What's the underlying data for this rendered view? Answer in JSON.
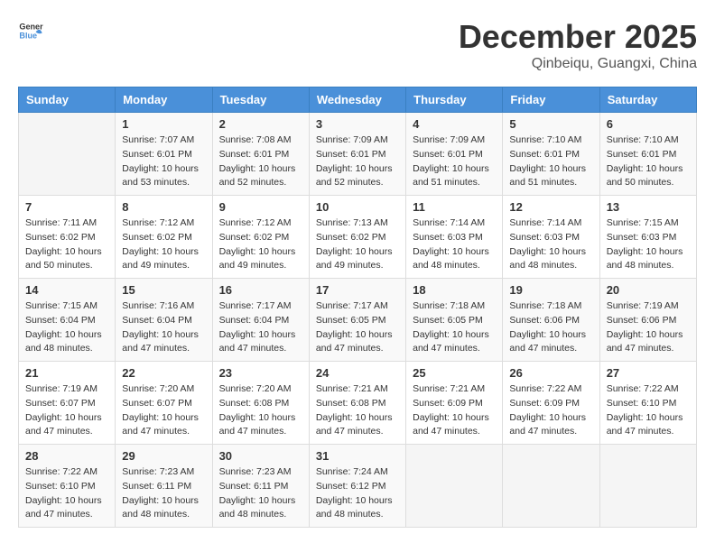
{
  "header": {
    "logo_general": "General",
    "logo_blue": "Blue",
    "month": "December 2025",
    "location": "Qinbeiqu, Guangxi, China"
  },
  "weekdays": [
    "Sunday",
    "Monday",
    "Tuesday",
    "Wednesday",
    "Thursday",
    "Friday",
    "Saturday"
  ],
  "weeks": [
    [
      {
        "day": "",
        "sunrise": "",
        "sunset": "",
        "daylight": ""
      },
      {
        "day": "1",
        "sunrise": "Sunrise: 7:07 AM",
        "sunset": "Sunset: 6:01 PM",
        "daylight": "Daylight: 10 hours and 53 minutes."
      },
      {
        "day": "2",
        "sunrise": "Sunrise: 7:08 AM",
        "sunset": "Sunset: 6:01 PM",
        "daylight": "Daylight: 10 hours and 52 minutes."
      },
      {
        "day": "3",
        "sunrise": "Sunrise: 7:09 AM",
        "sunset": "Sunset: 6:01 PM",
        "daylight": "Daylight: 10 hours and 52 minutes."
      },
      {
        "day": "4",
        "sunrise": "Sunrise: 7:09 AM",
        "sunset": "Sunset: 6:01 PM",
        "daylight": "Daylight: 10 hours and 51 minutes."
      },
      {
        "day": "5",
        "sunrise": "Sunrise: 7:10 AM",
        "sunset": "Sunset: 6:01 PM",
        "daylight": "Daylight: 10 hours and 51 minutes."
      },
      {
        "day": "6",
        "sunrise": "Sunrise: 7:10 AM",
        "sunset": "Sunset: 6:01 PM",
        "daylight": "Daylight: 10 hours and 50 minutes."
      }
    ],
    [
      {
        "day": "7",
        "sunrise": "Sunrise: 7:11 AM",
        "sunset": "Sunset: 6:02 PM",
        "daylight": "Daylight: 10 hours and 50 minutes."
      },
      {
        "day": "8",
        "sunrise": "Sunrise: 7:12 AM",
        "sunset": "Sunset: 6:02 PM",
        "daylight": "Daylight: 10 hours and 49 minutes."
      },
      {
        "day": "9",
        "sunrise": "Sunrise: 7:12 AM",
        "sunset": "Sunset: 6:02 PM",
        "daylight": "Daylight: 10 hours and 49 minutes."
      },
      {
        "day": "10",
        "sunrise": "Sunrise: 7:13 AM",
        "sunset": "Sunset: 6:02 PM",
        "daylight": "Daylight: 10 hours and 49 minutes."
      },
      {
        "day": "11",
        "sunrise": "Sunrise: 7:14 AM",
        "sunset": "Sunset: 6:03 PM",
        "daylight": "Daylight: 10 hours and 48 minutes."
      },
      {
        "day": "12",
        "sunrise": "Sunrise: 7:14 AM",
        "sunset": "Sunset: 6:03 PM",
        "daylight": "Daylight: 10 hours and 48 minutes."
      },
      {
        "day": "13",
        "sunrise": "Sunrise: 7:15 AM",
        "sunset": "Sunset: 6:03 PM",
        "daylight": "Daylight: 10 hours and 48 minutes."
      }
    ],
    [
      {
        "day": "14",
        "sunrise": "Sunrise: 7:15 AM",
        "sunset": "Sunset: 6:04 PM",
        "daylight": "Daylight: 10 hours and 48 minutes."
      },
      {
        "day": "15",
        "sunrise": "Sunrise: 7:16 AM",
        "sunset": "Sunset: 6:04 PM",
        "daylight": "Daylight: 10 hours and 47 minutes."
      },
      {
        "day": "16",
        "sunrise": "Sunrise: 7:17 AM",
        "sunset": "Sunset: 6:04 PM",
        "daylight": "Daylight: 10 hours and 47 minutes."
      },
      {
        "day": "17",
        "sunrise": "Sunrise: 7:17 AM",
        "sunset": "Sunset: 6:05 PM",
        "daylight": "Daylight: 10 hours and 47 minutes."
      },
      {
        "day": "18",
        "sunrise": "Sunrise: 7:18 AM",
        "sunset": "Sunset: 6:05 PM",
        "daylight": "Daylight: 10 hours and 47 minutes."
      },
      {
        "day": "19",
        "sunrise": "Sunrise: 7:18 AM",
        "sunset": "Sunset: 6:06 PM",
        "daylight": "Daylight: 10 hours and 47 minutes."
      },
      {
        "day": "20",
        "sunrise": "Sunrise: 7:19 AM",
        "sunset": "Sunset: 6:06 PM",
        "daylight": "Daylight: 10 hours and 47 minutes."
      }
    ],
    [
      {
        "day": "21",
        "sunrise": "Sunrise: 7:19 AM",
        "sunset": "Sunset: 6:07 PM",
        "daylight": "Daylight: 10 hours and 47 minutes."
      },
      {
        "day": "22",
        "sunrise": "Sunrise: 7:20 AM",
        "sunset": "Sunset: 6:07 PM",
        "daylight": "Daylight: 10 hours and 47 minutes."
      },
      {
        "day": "23",
        "sunrise": "Sunrise: 7:20 AM",
        "sunset": "Sunset: 6:08 PM",
        "daylight": "Daylight: 10 hours and 47 minutes."
      },
      {
        "day": "24",
        "sunrise": "Sunrise: 7:21 AM",
        "sunset": "Sunset: 6:08 PM",
        "daylight": "Daylight: 10 hours and 47 minutes."
      },
      {
        "day": "25",
        "sunrise": "Sunrise: 7:21 AM",
        "sunset": "Sunset: 6:09 PM",
        "daylight": "Daylight: 10 hours and 47 minutes."
      },
      {
        "day": "26",
        "sunrise": "Sunrise: 7:22 AM",
        "sunset": "Sunset: 6:09 PM",
        "daylight": "Daylight: 10 hours and 47 minutes."
      },
      {
        "day": "27",
        "sunrise": "Sunrise: 7:22 AM",
        "sunset": "Sunset: 6:10 PM",
        "daylight": "Daylight: 10 hours and 47 minutes."
      }
    ],
    [
      {
        "day": "28",
        "sunrise": "Sunrise: 7:22 AM",
        "sunset": "Sunset: 6:10 PM",
        "daylight": "Daylight: 10 hours and 47 minutes."
      },
      {
        "day": "29",
        "sunrise": "Sunrise: 7:23 AM",
        "sunset": "Sunset: 6:11 PM",
        "daylight": "Daylight: 10 hours and 48 minutes."
      },
      {
        "day": "30",
        "sunrise": "Sunrise: 7:23 AM",
        "sunset": "Sunset: 6:11 PM",
        "daylight": "Daylight: 10 hours and 48 minutes."
      },
      {
        "day": "31",
        "sunrise": "Sunrise: 7:24 AM",
        "sunset": "Sunset: 6:12 PM",
        "daylight": "Daylight: 10 hours and 48 minutes."
      },
      {
        "day": "",
        "sunrise": "",
        "sunset": "",
        "daylight": ""
      },
      {
        "day": "",
        "sunrise": "",
        "sunset": "",
        "daylight": ""
      },
      {
        "day": "",
        "sunrise": "",
        "sunset": "",
        "daylight": ""
      }
    ]
  ]
}
